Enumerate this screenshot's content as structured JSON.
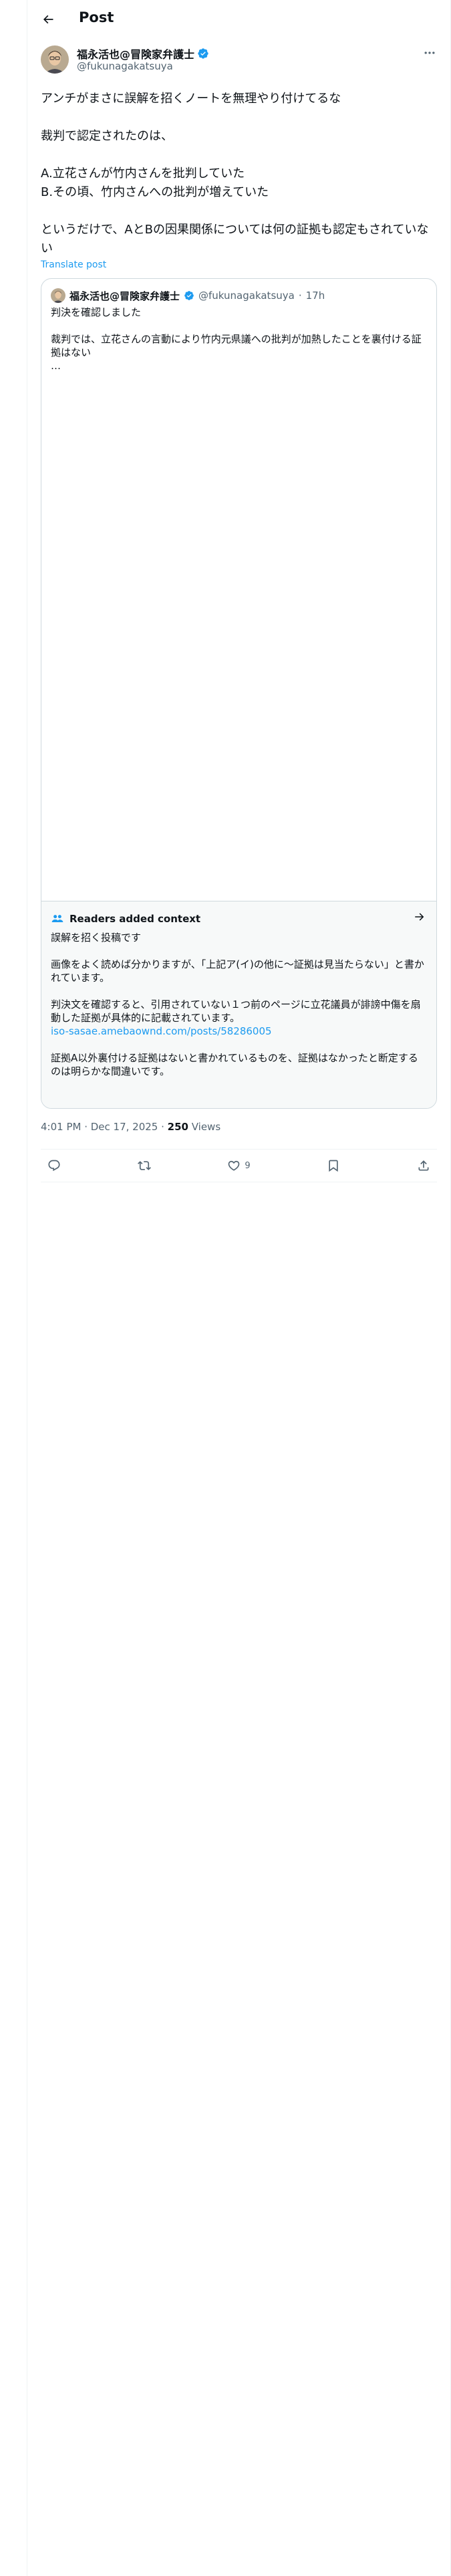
{
  "header": {
    "title": "Post"
  },
  "author": {
    "name": "福永活也@冒険家弁護士",
    "handle": "@fukunagakatsuya"
  },
  "tweet": {
    "lines": [
      "アンチがまさに誤解を招くノートを無理やり付けてるな",
      "",
      "裁判で認定されたのは、",
      "",
      "A.立花さんが竹内さんを批判していた",
      "B.その頃、竹内さんへの批判が増えていた",
      "",
      "というだけで、AとBの因果関係については何の証拠も認定もされていない"
    ],
    "translate_label": "Translate post"
  },
  "quote": {
    "name": "福永活也@冒険家弁護士",
    "handle": "@fukunagakatsuya",
    "time": "17h",
    "lines": [
      "判決を確認しました",
      "",
      "裁判では、立花さんの言動により竹内元県議への批判が加熱したことを裏付ける証拠はない",
      "…"
    ]
  },
  "context": {
    "title": "Readers added context",
    "lines": [
      "誤解を招く投稿です",
      "",
      "画像をよく読めば分かりますが、「上記ア(イ)の他に〜証拠は見当たらない」と書かれています。",
      "",
      "判決文を確認すると、引用されていない１つ前のページに立花議員が誹謗中傷を扇動した証拠が具体的に記載されています。"
    ],
    "link": "iso-sasae.amebaownd.com/posts/58286005",
    "closing": "証拠A以外裏付ける証拠はないと書かれているものを、証拠はなかったと断定するのは明らかな間違いです。"
  },
  "meta": {
    "timestamp": "4:01 PM · Dec 17, 2025 · ",
    "views_count": "250",
    "views_label": " Views"
  },
  "actions": {
    "likes": "9"
  },
  "colors": {
    "accent": "#1d9bf0",
    "verified": "#1d9bf0",
    "muted": "#536471",
    "context_bg": "#f7f9f9"
  },
  "icons": [
    "back-arrow-icon",
    "verified-badge-icon",
    "more-icon",
    "readers-icon",
    "arrow-right-icon",
    "reply-icon",
    "repost-icon",
    "like-icon",
    "bookmark-icon",
    "share-icon"
  ]
}
